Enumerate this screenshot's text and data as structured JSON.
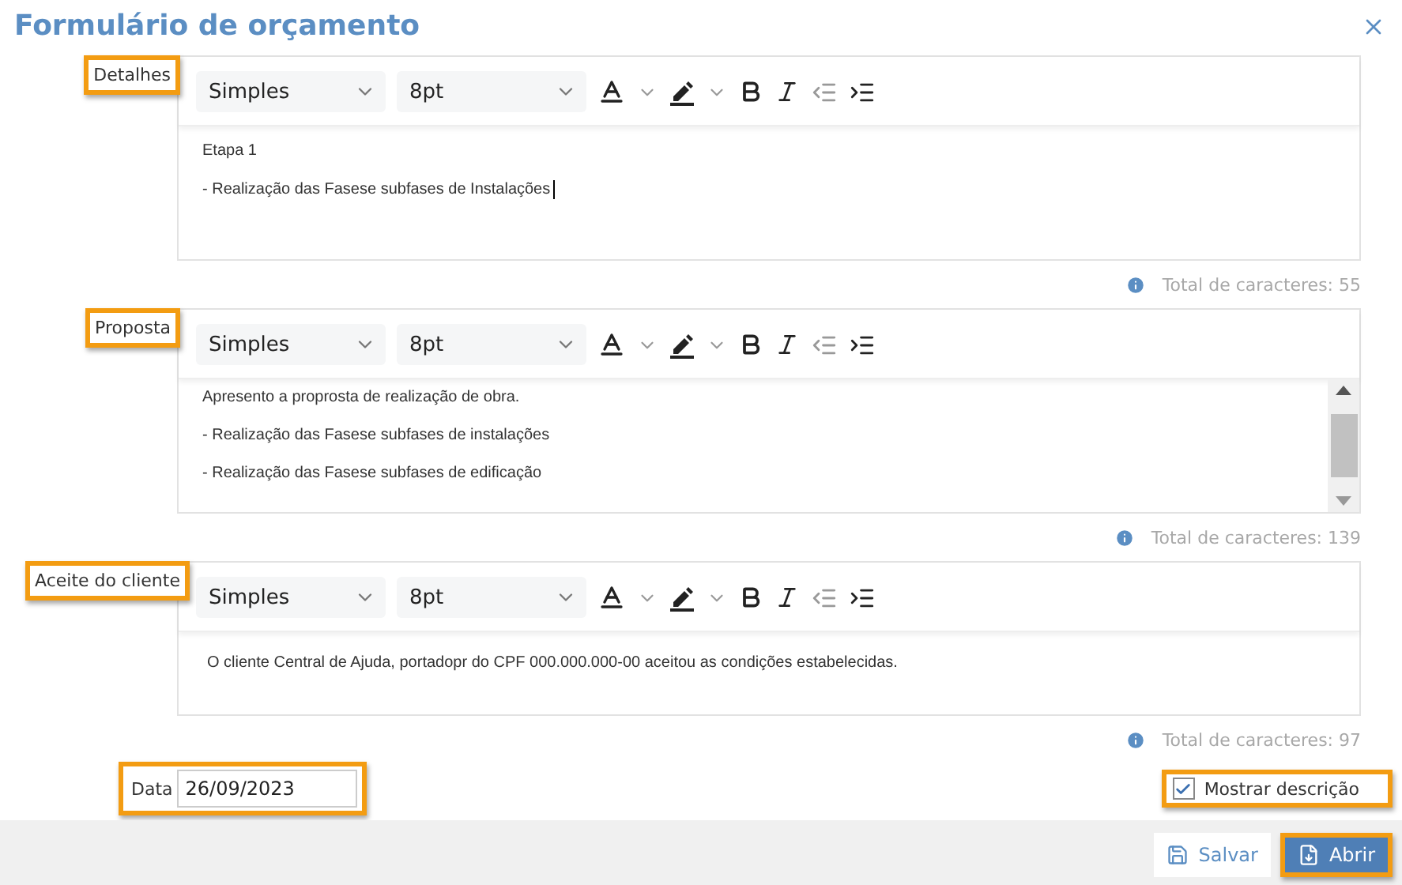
{
  "title": "Formulário de orçamento",
  "editors": [
    {
      "label": "Detalhes",
      "highlighted": true,
      "style": "Simples",
      "size": "8pt",
      "focused": true,
      "lines": [
        "Etapa 1",
        "- Realização das Fasese subfases de Instalações"
      ],
      "count": "Total de caracteres: 55"
    },
    {
      "label": "Proposta",
      "highlighted": true,
      "style": "Simples",
      "size": "8pt",
      "focused": false,
      "lines": [
        "Apresento a proprosta de realização de obra.",
        "- Realização das Fasese subfases de instalações",
        "- Realização das Fasese subfases de edificação"
      ],
      "count": "Total de caracteres: 139"
    },
    {
      "label": "Aceite do cliente",
      "highlighted": true,
      "style": "Simples",
      "size": "8pt",
      "focused": false,
      "lines": [
        "O cliente Central de Ajuda, portadopr do CPF 000.000.000-00 aceitou as condições estabelecidas."
      ],
      "count": "Total de caracteres: 97"
    }
  ],
  "date": {
    "label": "Data",
    "value": "26/09/2023",
    "highlighted": true
  },
  "show_description": {
    "label": "Mostrar descrição",
    "checked": true,
    "highlighted": true
  },
  "buttons": [
    {
      "label": "Salvar",
      "kind": "secondary",
      "highlighted": false
    },
    {
      "label": "Abrir",
      "kind": "primary",
      "highlighted": true
    }
  ]
}
